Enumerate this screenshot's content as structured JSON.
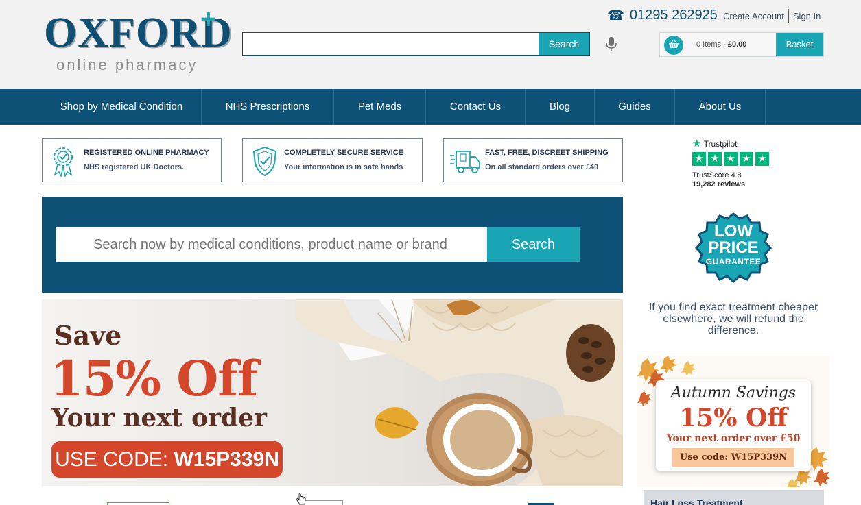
{
  "logo": {
    "main": "OXFORD",
    "plus": "+",
    "sub": "online pharmacy"
  },
  "header": {
    "search_button": "Search",
    "search_placeholder": "",
    "phone": "01295 262925",
    "create_account": "Create Account",
    "sign_in": "Sign In",
    "basket": {
      "items": "0 Items",
      "separator": " - ",
      "total": "£0.00",
      "button": "Basket"
    }
  },
  "nav": {
    "items": [
      {
        "label": "Shop by Medical Condition"
      },
      {
        "label": "NHS Prescriptions"
      },
      {
        "label": "Pet Meds"
      },
      {
        "label": "Contact Us"
      },
      {
        "label": "Blog"
      },
      {
        "label": "Guides"
      },
      {
        "label": "About Us"
      }
    ]
  },
  "features": [
    {
      "title": "REGISTERED ONLINE PHARMACY",
      "subtitle": "NHS registered UK Doctors.",
      "icon": "rosette-check-icon"
    },
    {
      "title": "COMPLETELY SECURE SERVICE",
      "subtitle": "Your information is in safe hands",
      "icon": "shield-check-icon"
    },
    {
      "title": "FAST, FREE, DISCREET SHIPPING",
      "subtitle": "On all standard orders over £40",
      "icon": "delivery-van-icon"
    }
  ],
  "big_search": {
    "placeholder": "Search now by medical conditions, product name or brand",
    "button": "Search"
  },
  "banner": {
    "save": "Save",
    "percent": "15% Off",
    "next_order": "Your next order",
    "code_label": "USE CODE: ",
    "code": "W15P339N"
  },
  "sidebar": {
    "trustpilot": {
      "name": "Trustpilot",
      "score_label": "TrustScore 4.8",
      "reviews": "19,282 reviews",
      "stars": 5
    },
    "low_price": {
      "line1": "LOW",
      "line2": "PRICE",
      "line3": "GUARANTEE"
    },
    "refund_text": "If you find exact treatment cheaper elsewhere, we will refund the difference.",
    "autumn": {
      "title": "Autumn Savings",
      "percent": "15% Off",
      "next_order": "Your next order over £50",
      "code": "Use code: W15P339N"
    },
    "hairloss": "Hair Loss Treatment"
  },
  "colors": {
    "navy": "#0e5177",
    "teal": "#1aa5b4",
    "offer_orange": "#d4472a",
    "trustpilot_green": "#00b67a"
  }
}
